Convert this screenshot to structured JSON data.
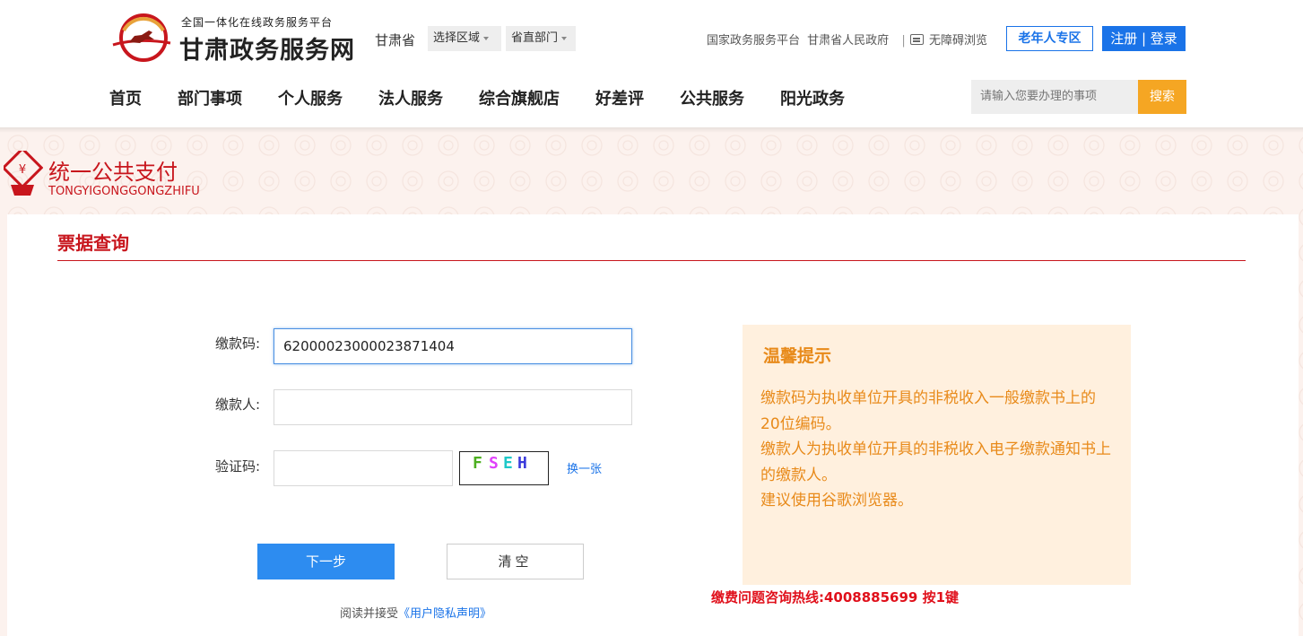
{
  "header": {
    "logo_subtitle": "全国一体化在线政务服务平台",
    "logo_title": "甘肃政务服务网",
    "province": "甘肃省",
    "region_select": "选择区域",
    "dept_select": "省直部门",
    "links": [
      "国家政务服务平台",
      "甘肃省人民政府"
    ],
    "link_separator": "|",
    "accessibility": "无障碍浏览",
    "elder_zone": "老年人专区",
    "login": "注册 | 登录",
    "nav": [
      "首页",
      "部门事项",
      "个人服务",
      "法人服务",
      "综合旗舰店",
      "好差评",
      "公共服务",
      "阳光政务"
    ],
    "search_placeholder": "请输入您要办理的事项",
    "search_button": "搜索"
  },
  "banner": {
    "title": "统一公共支付",
    "pinyin": "TONGYIGONGGONGZHIFU"
  },
  "form": {
    "section_title": "票据查询",
    "payment_code_label": "缴款码:",
    "payment_code_value": "62000023000023871404",
    "payer_label": "缴款人:",
    "payer_value": "",
    "captcha_label": "验证码:",
    "captcha_value": "",
    "captcha_chars": [
      "F",
      "S",
      "E",
      "H"
    ],
    "captcha_colors": [
      "#4caf20",
      "#e040fb",
      "#1ec8c8",
      "#3a3adb"
    ],
    "refresh_captcha": "换一张",
    "next_button": "下一步",
    "clear_button": "清空",
    "privacy_prefix": "阅读并接受",
    "privacy_link": "《用户隐私声明》"
  },
  "tips": {
    "title": "温馨提示",
    "lines": [
      "缴款码为执收单位开具的非税收入一般缴款书上的20位编码。",
      "缴款人为执收单位开具的非税收入电子缴款通知书上的缴款人。",
      "建议使用谷歌浏览器。"
    ],
    "hotline": "缴费问题咨询热线:4008885699 按1键"
  },
  "colors": {
    "brand_red": "#c8161d",
    "primary_blue": "#1a73e8",
    "search_orange": "#f5a623",
    "tips_orange": "#e88a1a",
    "tips_bg": "#fff0de"
  }
}
